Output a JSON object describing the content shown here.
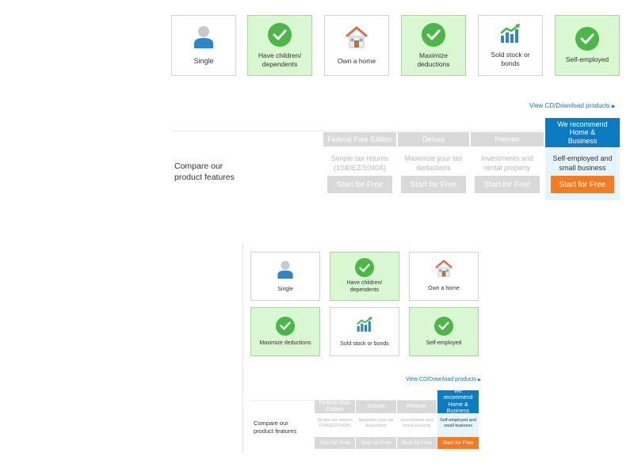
{
  "filters": [
    {
      "label": "Single",
      "selected": false,
      "icon": "person-icon"
    },
    {
      "label": "Have children/ dependents",
      "selected": true,
      "icon": "check-circle-icon"
    },
    {
      "label": "Own a home",
      "selected": false,
      "icon": "house-icon"
    },
    {
      "label": "Maximize deductions",
      "selected": true,
      "icon": "check-circle-icon"
    },
    {
      "label": "Sold stock or bonds",
      "selected": false,
      "icon": "stock-chart-icon"
    },
    {
      "label": "Self-employed",
      "selected": true,
      "icon": "check-circle-icon"
    }
  ],
  "small_filters": [
    {
      "label": "Single"
    },
    {
      "label": "Have children/ dependents"
    },
    {
      "label": "Own a home"
    },
    {
      "label": "Maximize deductions"
    },
    {
      "label": "Sold stock or bonds"
    },
    {
      "label": "Self-employed"
    }
  ],
  "cd_link": "View CD/Download products",
  "compare_label": "Compare our product features",
  "products": [
    {
      "header": "Federal Free Edition",
      "desc": "Simple tax returns (1040EZ/1040A)",
      "button": "Start for Free",
      "recommended": false
    },
    {
      "header": "Deluxe",
      "desc": "Maximize your tax deductions",
      "button": "Start for Free",
      "recommended": false
    },
    {
      "header": "Premier",
      "desc": "Investments and rental property",
      "button": "Start for Free",
      "recommended": false
    },
    {
      "header": "We recommend Home & Business",
      "desc": "Self-employed and small business",
      "button": "Start for Free",
      "recommended": true
    }
  ],
  "colors": {
    "selected_tile": "#d9f7d1",
    "check_green": "#4cb648",
    "recommend_blue": "#0b7bc2",
    "cta_orange": "#f47b20",
    "disabled_gray": "#d9d9d9"
  }
}
